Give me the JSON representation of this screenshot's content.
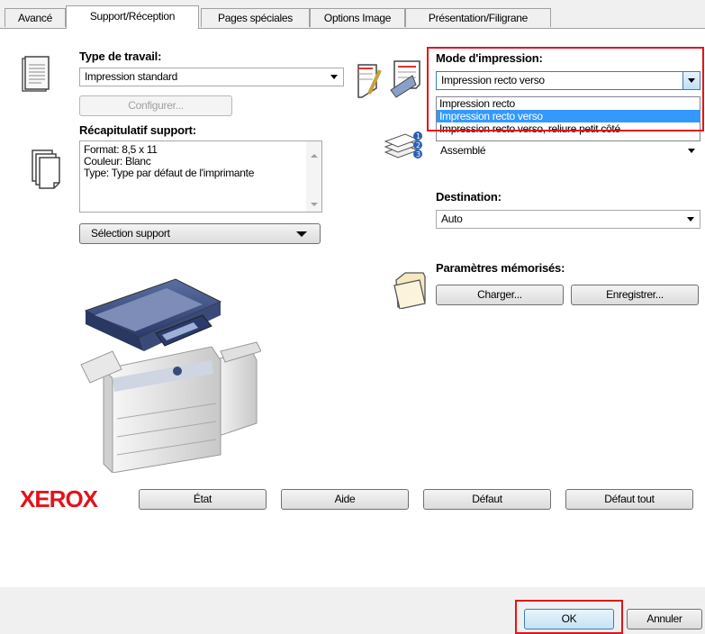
{
  "tabs": [
    {
      "label": "Avancé",
      "active": false
    },
    {
      "label": "Support/Réception",
      "active": true
    },
    {
      "label": "Pages spéciales",
      "active": false
    },
    {
      "label": "Options Image",
      "active": false
    },
    {
      "label": "Présentation/Filigrane",
      "active": false
    }
  ],
  "job_type": {
    "label": "Type de travail:",
    "value": "Impression standard",
    "configure_label": "Configurer..."
  },
  "media_summary": {
    "label": "Récapitulatif support:",
    "lines": [
      "Format: 8,5 x 11",
      "Couleur: Blanc",
      "Type: Type par défaut de l'imprimante"
    ],
    "select_label": "Sélection support"
  },
  "print_mode": {
    "label": "Mode  d'impression:",
    "value": "Impression recto verso",
    "options": [
      "Impression recto",
      "Impression recto verso",
      "Impression recto verso, reliure petit côté"
    ],
    "selected_index": 1
  },
  "collation": {
    "value": "Assemblé"
  },
  "destination": {
    "label": "Destination:",
    "value": "Auto"
  },
  "saved_settings": {
    "label": "Paramètres mémorisés:",
    "load_label": "Charger...",
    "save_label": "Enregistrer..."
  },
  "brand": {
    "name": "XEROX",
    "color": "#e3131b"
  },
  "bottom_buttons": {
    "status": "État",
    "help": "Aide",
    "default": "Défaut",
    "default_all": "Défaut tout"
  },
  "dialog_buttons": {
    "ok": "OK",
    "cancel": "Annuler"
  },
  "highlight_color": "#e3131b"
}
